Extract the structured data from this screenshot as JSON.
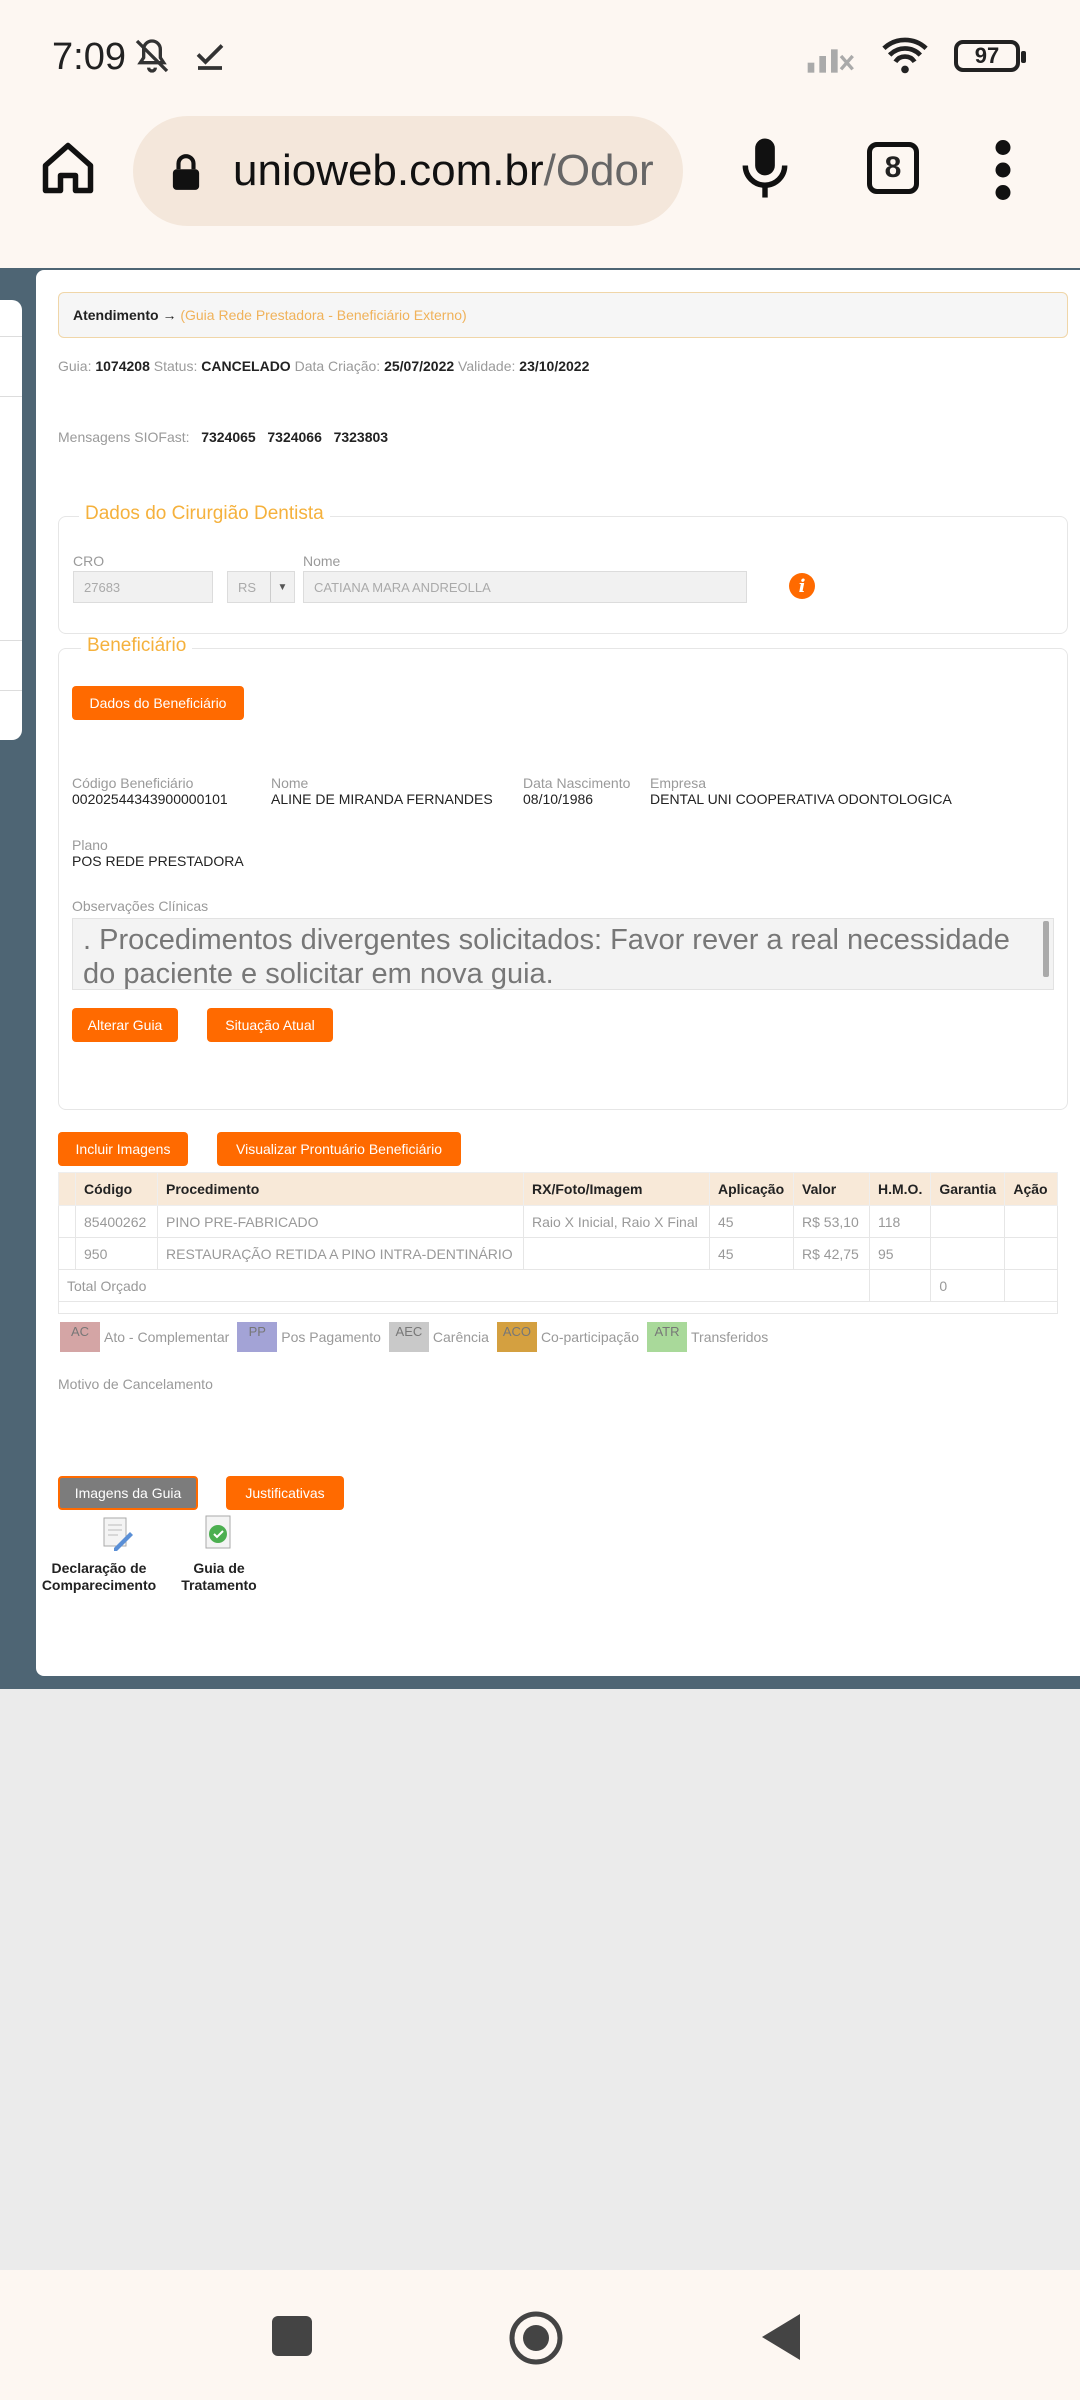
{
  "status": {
    "time": "7:09",
    "battery": "97"
  },
  "browser": {
    "url_domain": "unioweb.com.br",
    "url_path": "/Odor",
    "tab_count": "8"
  },
  "breadcrumb": {
    "main": "Atendimento",
    "arrow": "→",
    "sub": "(Guia Rede Prestadora - Beneficiário Externo)"
  },
  "guia": {
    "guia_label": "Guia:",
    "guia_value": "1074208",
    "status_label": "Status:",
    "status_value": "CANCELADO",
    "criacao_label": "Data Criação:",
    "criacao_value": "25/07/2022",
    "validade_label": "Validade:",
    "validade_value": "23/10/2022"
  },
  "mensagens": {
    "label": "Mensagens SIOFast:",
    "values": [
      "7324065",
      "7324066",
      "7323803"
    ]
  },
  "dentista": {
    "legend": "Dados do Cirurgião Dentista",
    "cro_label": "CRO",
    "cro_value": "27683",
    "uf_value": "RS",
    "nome_label": "Nome",
    "nome_value": "CATIANA MARA ANDREOLLA"
  },
  "beneficiario": {
    "legend": "Beneficiário",
    "dados_button": "Dados do Beneficiário",
    "codigo_label": "Código Beneficiário",
    "codigo_value": "00202544343900000101",
    "nome_label": "Nome",
    "nome_value": "ALINE DE MIRANDA FERNANDES",
    "nasc_label": "Data Nascimento",
    "nasc_value": "08/10/1986",
    "empresa_label": "Empresa",
    "empresa_value": "DENTAL UNI COOPERATIVA ODONTOLOGICA",
    "plano_label": "Plano",
    "plano_value": "POS REDE PRESTADORA",
    "obs_label": "Observações Clínicas",
    "obs_text": ". Procedimentos divergentes solicitados: Favor rever a real necessidade do paciente e solicitar em nova guia.",
    "alterar_button": "Alterar Guia",
    "situacao_button": "Situação Atual"
  },
  "actions": {
    "incluir": "Incluir Imagens",
    "visualizar": "Visualizar Prontuário Beneficiário"
  },
  "table": {
    "headers": [
      "Código",
      "Procedimento",
      "RX/Foto/Imagem",
      "Aplicação",
      "Valor",
      "H.M.O.",
      "Garantia",
      "Ação"
    ],
    "rows": [
      [
        "85400262",
        "PINO PRE-FABRICADO",
        "Raio X Inicial, Raio X Final",
        "45",
        "R$ 53,10",
        "118",
        "",
        ""
      ],
      [
        "950",
        "RESTAURAÇÃO RETIDA A PINO INTRA-DENTINÁRIO",
        "",
        "45",
        "R$ 42,75",
        "95",
        "",
        ""
      ]
    ],
    "total_label": "Total Orçado",
    "total_hmo": "0"
  },
  "legend_items": [
    {
      "code": "AC",
      "label": "Ato - Complementar",
      "color": "#d4a5a5"
    },
    {
      "code": "PP",
      "label": "Pos Pagamento",
      "color": "#a3a3d6"
    },
    {
      "code": "AEC",
      "label": "Carência",
      "color": "#c9c9c9"
    },
    {
      "code": "ACO",
      "label": "Co-participação",
      "color": "#d4a040"
    },
    {
      "code": "ATR",
      "label": "Transferidos",
      "color": "#a9d99a"
    }
  ],
  "cancelamento": {
    "label": "Motivo de Cancelamento"
  },
  "bottom": {
    "imagens_button": "Imagens da Guia",
    "justificativas_button": "Justificativas",
    "doc1_line1": "Declaração de",
    "doc1_line2": "Comparecimento",
    "doc2_line1": "Guia de",
    "doc2_line2": "Tratamento"
  }
}
